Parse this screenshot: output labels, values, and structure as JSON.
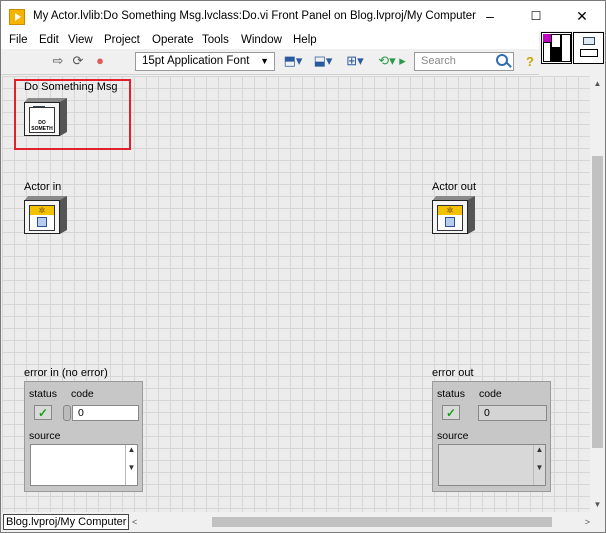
{
  "window": {
    "title": "My Actor.lvlib:Do Something Msg.lvclass:Do.vi Front Panel on Blog.lvproj/My Computer",
    "minimize": "–",
    "maximize": "☐",
    "close": "✕"
  },
  "menu": [
    "File",
    "Edit",
    "View",
    "Project",
    "Operate",
    "Tools",
    "Window",
    "Help"
  ],
  "toolbar": {
    "font_label": "15pt Application Font",
    "search_placeholder": "Search",
    "icons": [
      "run-arrow-icon",
      "run-continuously-icon",
      "abort-icon",
      "align-objects-icon",
      "distribute-objects-icon",
      "resize-objects-icon",
      "reorder-icon",
      "search-icon",
      "help-icon"
    ]
  },
  "panel": {
    "controls": {
      "do_something": {
        "label": "Do Something Msg",
        "icon_text": "DO\nSOMETH"
      },
      "actor_in": {
        "label": "Actor in"
      },
      "actor_out": {
        "label": "Actor out"
      }
    },
    "error_in": {
      "label": "error in (no error)",
      "status_label": "status",
      "code_label": "code",
      "code_value": "0",
      "source_label": "source",
      "status_mark": "✓"
    },
    "error_out": {
      "label": "error out",
      "status_label": "status",
      "code_label": "code",
      "code_value": "0",
      "source_label": "source",
      "status_mark": "✓"
    }
  },
  "statusbar": {
    "context_path": "Blog.lvproj/My Computer"
  },
  "colors": {
    "highlight": "#e0222c",
    "accent_gold": "#f2c200",
    "status_green": "#16a316"
  }
}
